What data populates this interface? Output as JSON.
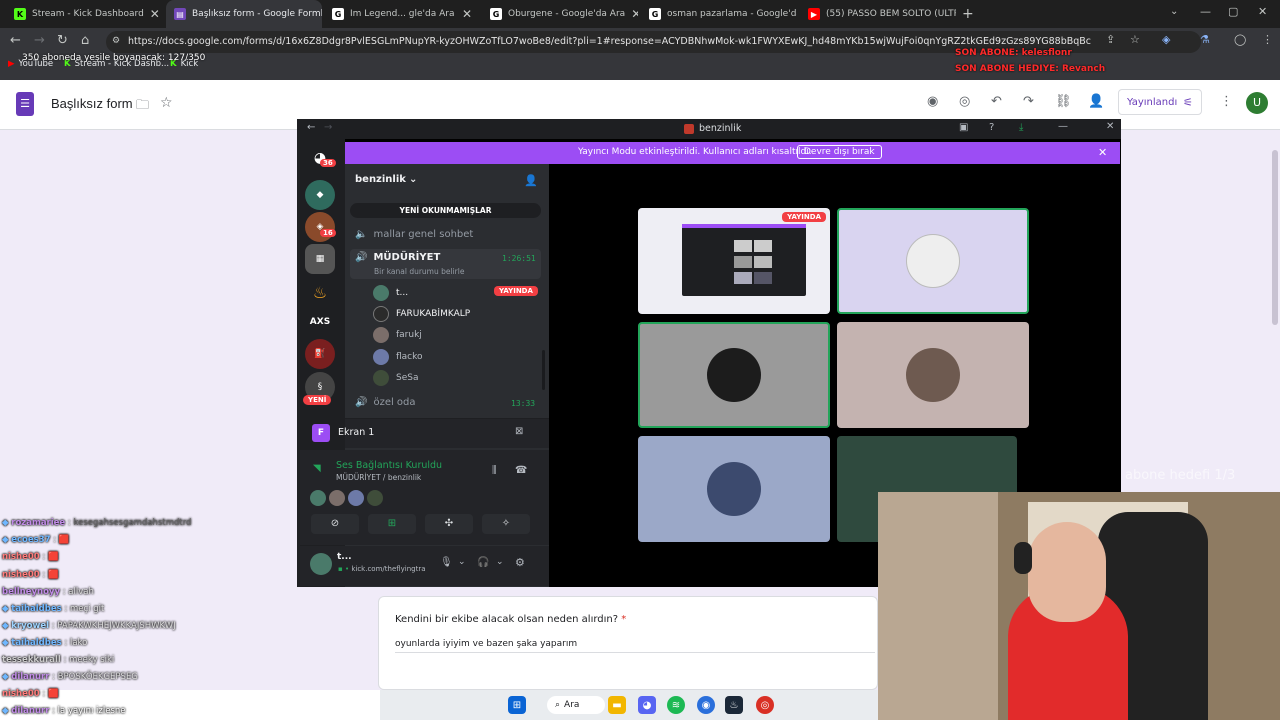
{
  "browser": {
    "tabs": [
      {
        "title": "Stream - Kick Dashboard",
        "fav": "kick-icon"
      },
      {
        "title": "Başlıksız form - Google Formlar",
        "fav": "forms-icon"
      },
      {
        "title": "Im Legend... gle'da Ara",
        "fav": "google-icon"
      },
      {
        "title": "Oburgene - Google'da Ara",
        "fav": "google-icon"
      },
      {
        "title": "osman pazarlama - Google'da A",
        "fav": "google-icon"
      },
      {
        "title": "(55) PASSO BEM SOLTO (ULTRA",
        "fav": "youtube-icon"
      }
    ],
    "url": "https://docs.google.com/forms/d/16x6Z8Ddgr8PvlESGLmPNupYR-kyzOHWZoTfLO7woBe8/edit?pli=1#response=ACYDBNhwMok-wk1FWYXEwKJ_hd48mYKb15wjWujFoi0qnYgRZ2tkGEd9zGzs89YG88bBqBc",
    "bookmarks": [
      "YouTube",
      "Stream - Kick Dashb...",
      "Kick"
    ]
  },
  "overlay": {
    "subs_goal": "350 aboneda yeşile boyanacak: 127/350",
    "last_sub": "SON ABONE: kelesflonr",
    "last_gift": "SON ABONE HEDIYE: Revanch",
    "sub_target": "abone hedefi 1/3"
  },
  "forms": {
    "title": "Başlıksız form",
    "publish": "Yayınlandı",
    "avatar": "U",
    "question": "Kendini bir ekibe alacak olsan neden alırdın?",
    "required": "*",
    "answer": "oyunlarda iyiyim ve bazen şaka yaparım"
  },
  "discord": {
    "title": "benzinlik",
    "banner": "Yayıncı Modu etkinleştirildi. Kullanıcı adları kısaltıldı.",
    "banner_btn": "Devre dışı bırak",
    "server": "benzinlik",
    "unread": "YENİ OKUNMAMIŞLAR",
    "guild_badges": [
      "36",
      "16"
    ],
    "guild_text": "AXS",
    "new_label": "YENİ",
    "channels": {
      "general": "mallar genel sohbet",
      "active": "MÜDÜRİYET",
      "active_time": "1:26:51",
      "status_hint": "Bir kanal durumu belirle",
      "other": "özel oda",
      "other_time": "13:33"
    },
    "members": [
      {
        "name": "t...",
        "live": "YAYINDA"
      },
      {
        "name": "FARUKABİMKALP"
      },
      {
        "name": "farukj"
      },
      {
        "name": "flacko"
      },
      {
        "name": "SeSa"
      }
    ],
    "screen": "Ekran 1",
    "voice_status": "Ses Bağlantısı Kuruldu",
    "voice_channel": "MÜDÜRİYET / benzinlik",
    "user_name": "t...",
    "user_sub": "kick.com/theflyingtra",
    "stage_live": "YAYINDA"
  },
  "chat": [
    {
      "user": "rozamariee",
      "msg": "kesegahsesgamdahstmdtrd",
      "color": "#c08be6"
    },
    {
      "user": "ecoes37",
      "msg": "🟥",
      "color": "#6fb7ff"
    },
    {
      "user": "nishe00",
      "msg": "🟥",
      "color": "#ff7b7b"
    },
    {
      "user": "nishe00",
      "msg": "🟥",
      "color": "#ff7b7b"
    },
    {
      "user": "bellneynoyy",
      "msg": "allvah",
      "color": "#c08be6"
    },
    {
      "user": "taihaldbes",
      "msg": "meçi git",
      "color": "#6fb7ff"
    },
    {
      "user": "kryowel",
      "msg": "PAPAKWKHEJWKKAJSHWKWJ",
      "color": "#9fd4ff"
    },
    {
      "user": "taihaldbes",
      "msg": "lako",
      "color": "#6fb7ff"
    },
    {
      "user": "tessekkurall",
      "msg": "meeky siki",
      "color": "#cccccc"
    },
    {
      "user": "dilanurr",
      "msg": "BPOSKÖEKGEPSEG",
      "color": "#c08be6"
    },
    {
      "user": "nishe00",
      "msg": "🟥",
      "color": "#ff7b7b"
    },
    {
      "user": "dilanurr",
      "msg": "la yayını izlesne",
      "color": "#c08be6"
    }
  ],
  "taskbar": {
    "search": "Ara"
  },
  "colors": {
    "discord_accent": "#9c4df4",
    "voice_green": "#23a55a",
    "forms_purple": "#673ab7"
  }
}
